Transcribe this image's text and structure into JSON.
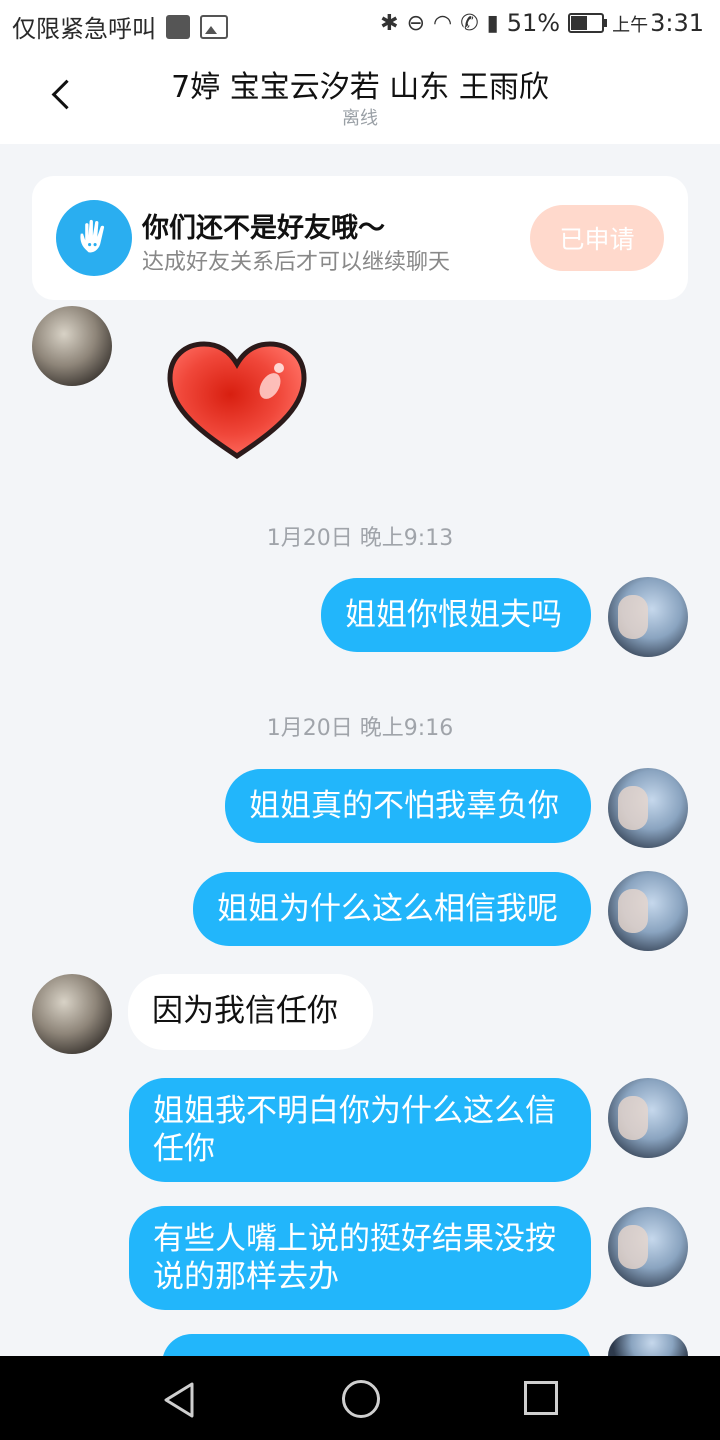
{
  "status_bar": {
    "emergency_text": "仅限紧急呼叫",
    "battery_percent": "51%",
    "ampm": "上午",
    "time": "3:31",
    "battery_level": 0.51
  },
  "header": {
    "title": "7婷 宝宝云汐若 山东 王雨欣",
    "status": "离线",
    "back_icon": "chevron-left-icon"
  },
  "friend_card": {
    "title": "你们还不是好友哦～",
    "subtitle": "达成好友关系后才可以继续聊天",
    "button_label": "已申请",
    "button_color": "#ffd9cc",
    "icon": "waving-hand-icon"
  },
  "chat": {
    "timestamps": [
      "1月20日 晚上9:13",
      "1月20日 晚上9:16"
    ],
    "messages": [
      {
        "from": "me",
        "text": "姐姐你恨姐夫吗"
      },
      {
        "from": "me",
        "text": "姐姐真的不怕我辜负你"
      },
      {
        "from": "me",
        "text": "姐姐为什么这么相信我呢"
      },
      {
        "from": "them",
        "text": "因为我信任你"
      },
      {
        "from": "me",
        "text": "姐姐我不明白你为什么这么信\n任你"
      },
      {
        "from": "me",
        "text": "有些人嘴上说的挺好结果没按\n说的那样去办"
      }
    ],
    "colors": {
      "me_bubble": "#22b6fb",
      "them_bubble": "#ffffff"
    }
  },
  "nav_bar": {
    "icons": [
      "back-triangle-icon",
      "home-circle-icon",
      "recent-apps-square-icon"
    ]
  }
}
